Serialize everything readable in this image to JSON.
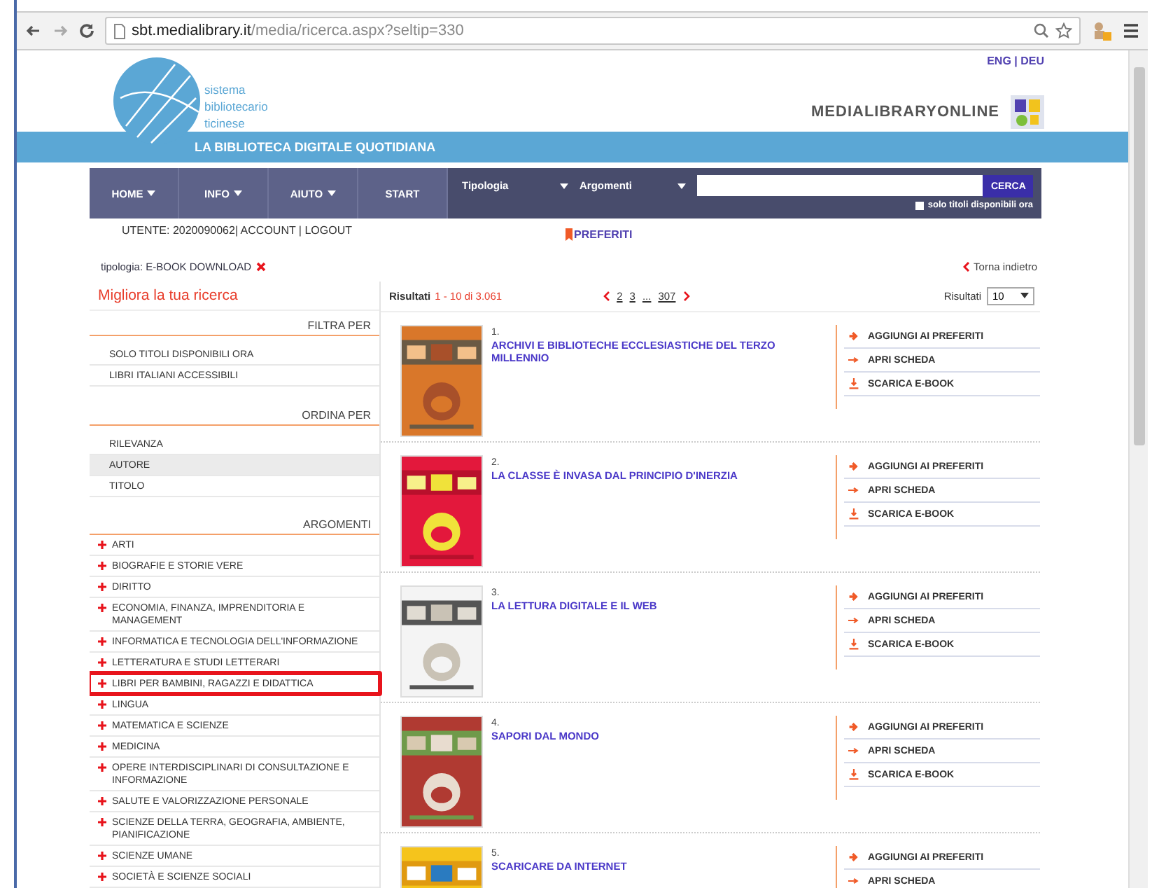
{
  "browser": {
    "address_host": "sbt.medialibrary.it",
    "address_path": "/media/ricerca.aspx?seltip=330"
  },
  "header": {
    "logo_text": "sistema bibliotecario ticinese",
    "languages": "ENG | DEU",
    "brand": "MEDIALIBRARYONLINE",
    "band_title": "LA BIBLIOTECA DIGITALE QUOTIDIANA"
  },
  "nav": {
    "menus": [
      {
        "label": "HOME",
        "dropdown": true
      },
      {
        "label": "INFO",
        "dropdown": true
      },
      {
        "label": "AIUTO",
        "dropdown": true
      },
      {
        "label": "START",
        "dropdown": false
      }
    ],
    "filters": [
      "Tipologia",
      "Argomenti"
    ],
    "search_button": "CERCA",
    "available_only": {
      "label": "solo titoli disponibili ora",
      "checked": false
    }
  },
  "user_bar": {
    "user": "UTENTE: 2020090062| ACCOUNT | LOGOUT",
    "favorites": "PREFERITI"
  },
  "active_filter": {
    "label": "tipologia: E-BOOK DOWNLOAD",
    "back": "Torna indietro"
  },
  "sidebar": {
    "title": "Migliora la tua ricerca",
    "sections": [
      {
        "heading": "FILTRA PER",
        "kind": "plain",
        "items": [
          {
            "label": "SOLO TITOLI DISPONIBILI ORA",
            "selected": false,
            "highlighted": false
          },
          {
            "label": "LIBRI ITALIANI ACCESSIBILI",
            "selected": false,
            "highlighted": false
          }
        ]
      },
      {
        "heading": "ORDINA PER",
        "kind": "plain",
        "items": [
          {
            "label": "RILEVANZA",
            "selected": false,
            "highlighted": false
          },
          {
            "label": "AUTORE",
            "selected": true,
            "highlighted": false
          },
          {
            "label": "TITOLO",
            "selected": false,
            "highlighted": false
          }
        ]
      },
      {
        "heading": "ARGOMENTI",
        "kind": "topics",
        "items": [
          {
            "label": "ARTI",
            "selected": false,
            "highlighted": false
          },
          {
            "label": "BIOGRAFIE E STORIE VERE",
            "selected": false,
            "highlighted": false
          },
          {
            "label": "DIRITTO",
            "selected": false,
            "highlighted": false
          },
          {
            "label": "ECONOMIA, FINANZA, IMPRENDITORIA E MANAGEMENT",
            "selected": false,
            "highlighted": false
          },
          {
            "label": "INFORMATICA E TECNOLOGIA DELL'INFORMAZIONE",
            "selected": false,
            "highlighted": false
          },
          {
            "label": "LETTERATURA E STUDI LETTERARI",
            "selected": false,
            "highlighted": false
          },
          {
            "label": "LIBRI PER BAMBINI, RAGAZZI E DIDATTICA",
            "selected": false,
            "highlighted": true
          },
          {
            "label": "LINGUA",
            "selected": false,
            "highlighted": false
          },
          {
            "label": "MATEMATICA E SCIENZE",
            "selected": false,
            "highlighted": false
          },
          {
            "label": "MEDICINA",
            "selected": false,
            "highlighted": false
          },
          {
            "label": "OPERE INTERDISCIPLINARI DI CONSULTAZIONE E INFORMAZIONE",
            "selected": false,
            "highlighted": false
          },
          {
            "label": "SALUTE E VALORIZZAZIONE PERSONALE",
            "selected": false,
            "highlighted": false
          },
          {
            "label": "SCIENZE DELLA TERRA, GEOGRAFIA, AMBIENTE, PIANIFICAZIONE",
            "selected": false,
            "highlighted": false
          },
          {
            "label": "SCIENZE UMANE",
            "selected": false,
            "highlighted": false
          },
          {
            "label": "SOCIETÀ E SCIENZE SOCIALI",
            "selected": false,
            "highlighted": false
          }
        ]
      }
    ]
  },
  "results_bar": {
    "label": "Risultati",
    "range": "1 - 10 di 3.061",
    "pages": [
      {
        "label": "2",
        "selected": false
      },
      {
        "label": "3",
        "selected": false
      },
      {
        "label": "...",
        "selected": false
      },
      {
        "label": "307",
        "selected": false
      }
    ],
    "per_page_label": "Risultati",
    "per_page": "10"
  },
  "results": [
    {
      "number": "1.",
      "title": "ARCHIVI E BIBLIOTECHE ECCLESIASTICHE DEL TERZO MILLENNIO",
      "actions": [
        {
          "kind": "add",
          "label": "AGGIUNGI AI PREFERITI"
        },
        {
          "kind": "open",
          "label": "APRI SCHEDA"
        },
        {
          "kind": "download",
          "label": "SCARICA E-BOOK"
        }
      ]
    },
    {
      "number": "2.",
      "title": "LA CLASSE È INVASA DAL PRINCIPIO D'INERZIA",
      "actions": [
        {
          "kind": "add",
          "label": "AGGIUNGI AI PREFERITI"
        },
        {
          "kind": "open",
          "label": "APRI SCHEDA"
        },
        {
          "kind": "download",
          "label": "SCARICA E-BOOK"
        }
      ]
    },
    {
      "number": "3.",
      "title": "LA LETTURA DIGITALE E IL WEB",
      "actions": [
        {
          "kind": "add",
          "label": "AGGIUNGI AI PREFERITI"
        },
        {
          "kind": "open",
          "label": "APRI SCHEDA"
        },
        {
          "kind": "download",
          "label": "SCARICA E-BOOK"
        }
      ]
    },
    {
      "number": "4.",
      "title": "SAPORI DAL MONDO",
      "actions": [
        {
          "kind": "add",
          "label": "AGGIUNGI AI PREFERITI"
        },
        {
          "kind": "open",
          "label": "APRI SCHEDA"
        },
        {
          "kind": "download",
          "label": "SCARICA E-BOOK"
        }
      ]
    },
    {
      "number": "5.",
      "title": "SCARICARE DA INTERNET",
      "actions": [
        {
          "kind": "add",
          "label": "AGGIUNGI AI PREFERITI"
        },
        {
          "kind": "open",
          "label": "APRI SCHEDA"
        }
      ]
    }
  ]
}
